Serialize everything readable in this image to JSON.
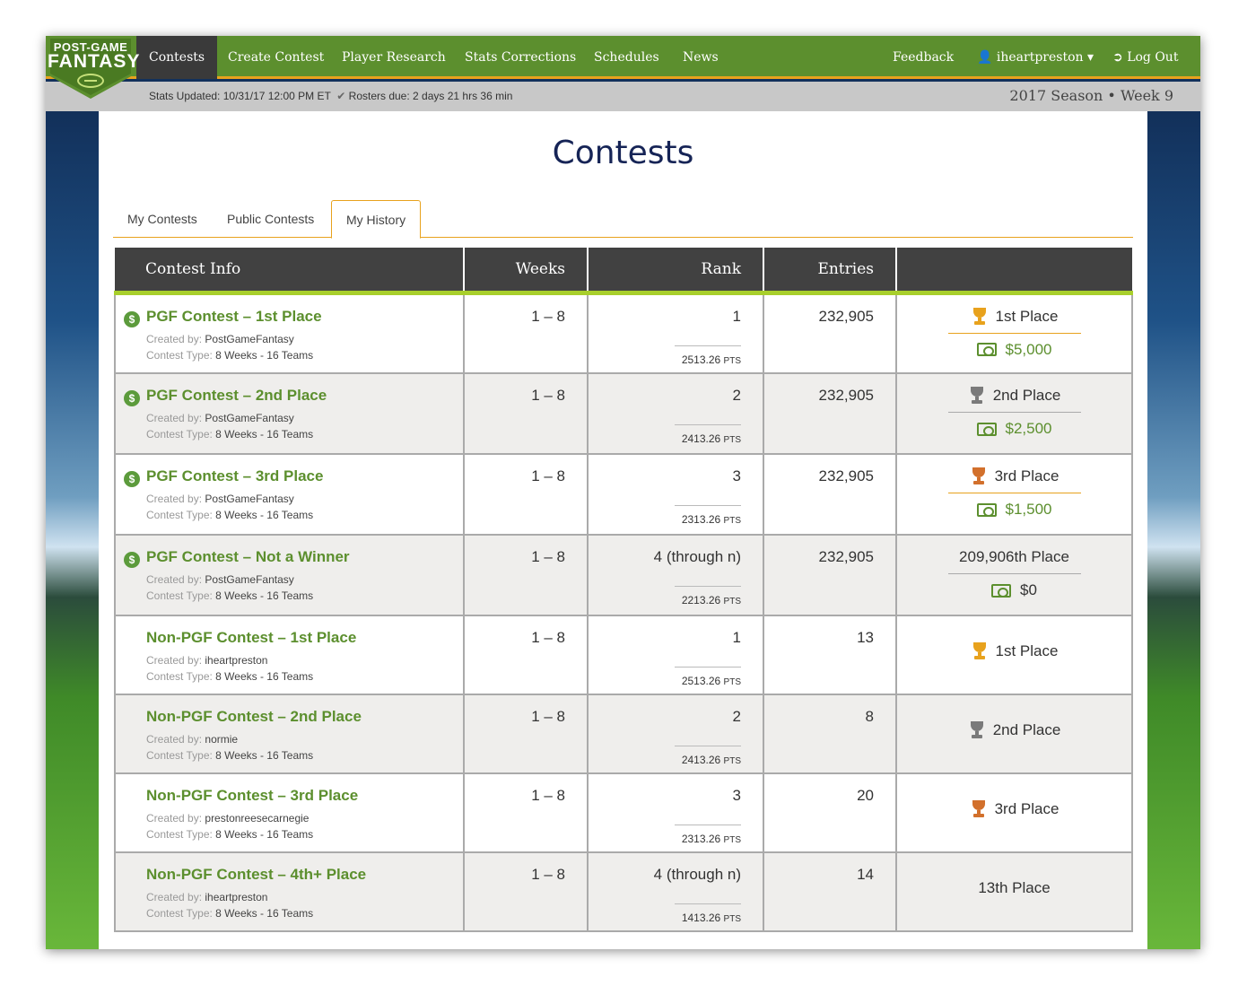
{
  "logo": {
    "line1": "POST-GAME",
    "line2": "FANTASY"
  },
  "nav": {
    "items": [
      "Contests",
      "Create Contest",
      "Player Research",
      "Stats Corrections",
      "Schedules",
      "News"
    ],
    "feedback": "Feedback",
    "user": "iheartpreston",
    "logout": "Log Out"
  },
  "status": {
    "updated": "Stats Updated: 10/31/17 12:00 PM ET",
    "rosters": "Rosters due: 2 days 21 hrs 36 min",
    "season": "2017 Season • Week 9"
  },
  "page": {
    "title": "Contests"
  },
  "tabs": [
    "My Contests",
    "Public Contests",
    "My History"
  ],
  "table": {
    "headers": [
      "Contest Info",
      "Weeks",
      "Rank",
      "Entries",
      ""
    ],
    "created_label": "Created by:",
    "type_label": "Contest Type:",
    "rows": [
      {
        "name": "PGF Contest – 1st Place",
        "creator": "PostGameFantasy",
        "type": "8 Weeks - 16 Teams",
        "weeks": "1 – 8",
        "rank": "1",
        "pts": "2513.26",
        "pts_unit": "PTS",
        "entries": "232,905",
        "place": "1st Place",
        "prize": "$5,000"
      },
      {
        "name": "PGF Contest – 2nd Place",
        "creator": "PostGameFantasy",
        "type": "8 Weeks - 16 Teams",
        "weeks": "1 – 8",
        "rank": "2",
        "pts": "2413.26",
        "pts_unit": "PTS",
        "entries": "232,905",
        "place": "2nd Place",
        "prize": "$2,500"
      },
      {
        "name": "PGF Contest – 3rd Place",
        "creator": "PostGameFantasy",
        "type": "8 Weeks - 16 Teams",
        "weeks": "1 – 8",
        "rank": "3",
        "pts": "2313.26",
        "pts_unit": "PTS",
        "entries": "232,905",
        "place": "3rd Place",
        "prize": "$1,500"
      },
      {
        "name": "PGF Contest – Not a Winner",
        "creator": "PostGameFantasy",
        "type": "8 Weeks - 16 Teams",
        "weeks": "1 – 8",
        "rank": "4 (through n)",
        "pts": "2213.26",
        "pts_unit": "PTS",
        "entries": "232,905",
        "place": "209,906th Place",
        "prize": "$0"
      },
      {
        "name": "Non-PGF Contest – 1st Place",
        "creator": "iheartpreston",
        "type": "8 Weeks - 16 Teams",
        "weeks": "1 – 8",
        "rank": "1",
        "pts": "2513.26",
        "pts_unit": "PTS",
        "entries": "13",
        "place": "1st Place"
      },
      {
        "name": "Non-PGF Contest – 2nd Place",
        "creator": "normie",
        "type": "8 Weeks - 16 Teams",
        "weeks": "1 – 8",
        "rank": "2",
        "pts": "2413.26",
        "pts_unit": "PTS",
        "entries": "8",
        "place": "2nd Place"
      },
      {
        "name": "Non-PGF Contest – 3rd Place",
        "creator": "prestonreesecarnegie",
        "type": "8 Weeks - 16 Teams",
        "weeks": "1 – 8",
        "rank": "3",
        "pts": "2313.26",
        "pts_unit": "PTS",
        "entries": "20",
        "place": "3rd Place"
      },
      {
        "name": "Non-PGF Contest – 4th+ Place",
        "creator": "iheartpreston",
        "type": "8 Weeks - 16 Teams",
        "weeks": "1 – 8",
        "rank": "4 (through n)",
        "pts": "1413.26",
        "pts_unit": "PTS",
        "entries": "14",
        "place": "13th Place"
      }
    ]
  },
  "colors": {
    "brand_green": "#5c8f2e",
    "accent_orange": "#e8a21d",
    "title_navy": "#162456",
    "header_dark": "#414141"
  }
}
